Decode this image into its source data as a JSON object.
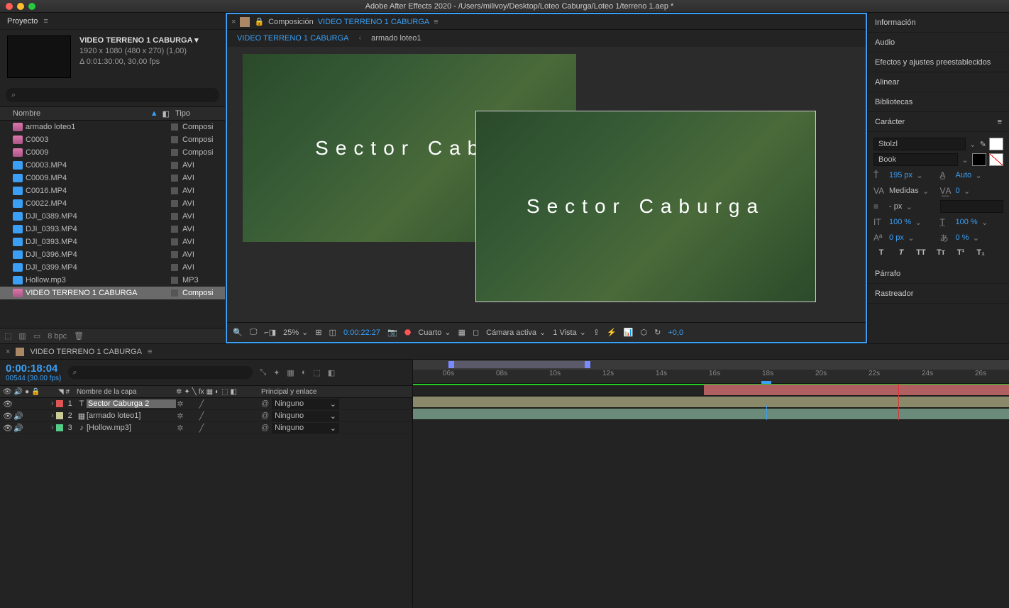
{
  "app": {
    "title": "Adobe After Effects 2020 - /Users/milivoy/Desktop/Loteo Caburga/Loteo 1/terreno 1.aep *"
  },
  "project": {
    "panel_title": "Proyecto",
    "comp_name": "VIDEO TERRENO 1 CABURGA ▾",
    "resolution": "1920 x 1080  (480 x 270) (1,00)",
    "duration": "Δ 0:01:30:00, 30,00 fps",
    "search_icon": "⌕",
    "columns": {
      "name": "Nombre",
      "type": "Tipo"
    },
    "items": [
      {
        "name": "armado loteo1",
        "type": "Composi",
        "icon": "comp"
      },
      {
        "name": "C0003",
        "type": "Composi",
        "icon": "comp"
      },
      {
        "name": "C0009",
        "type": "Composi",
        "icon": "comp"
      },
      {
        "name": "C0003.MP4",
        "type": "AVI",
        "icon": "avi"
      },
      {
        "name": "C0009.MP4",
        "type": "AVI",
        "icon": "avi"
      },
      {
        "name": "C0016.MP4",
        "type": "AVI",
        "icon": "avi"
      },
      {
        "name": "C0022.MP4",
        "type": "AVI",
        "icon": "avi"
      },
      {
        "name": "DJI_0389.MP4",
        "type": "AVI",
        "icon": "avi"
      },
      {
        "name": "DJI_0393.MP4",
        "type": "AVI",
        "icon": "avi"
      },
      {
        "name": "DJI_0393.MP4",
        "type": "AVI",
        "icon": "avi"
      },
      {
        "name": "DJI_0396.MP4",
        "type": "AVI",
        "icon": "avi"
      },
      {
        "name": "DJI_0399.MP4",
        "type": "AVI",
        "icon": "avi"
      },
      {
        "name": "Hollow.mp3",
        "type": "MP3",
        "icon": "mp3"
      },
      {
        "name": "VIDEO TERRENO 1 CABURGA",
        "type": "Composi",
        "icon": "comp",
        "selected": true
      }
    ],
    "footer_bpc": "8 bpc"
  },
  "viewer": {
    "tab_prefix": "Composición",
    "tab_name": "VIDEO TERRENO 1 CABURGA",
    "breadcrumb": [
      {
        "label": "VIDEO TERRENO 1 CABURGA",
        "active": true
      },
      {
        "label": "armado loteo1",
        "active": false
      }
    ],
    "overlay_text_1": "Sector Cabu",
    "overlay_text_2": "Sector Caburga",
    "footer": {
      "zoom": "25%",
      "timecode": "0:00:22:27",
      "quality": "Cuarto",
      "camera": "Cámara activa",
      "views": "1 Vista",
      "exposure": "+0,0"
    }
  },
  "right_panels": {
    "info": "Información",
    "audio": "Audio",
    "effects": "Efectos y ajustes preestablecidos",
    "align": "Alinear",
    "libraries": "Bibliotecas",
    "character": "Carácter",
    "paragraph": "Párrafo",
    "tracker": "Rastreador"
  },
  "character": {
    "font": "Stolzl",
    "style": "Book",
    "size_value": "195",
    "size_unit": "px",
    "leading": "Auto",
    "kerning_label": "Medidas",
    "tracking": "0",
    "stroke_value": "-",
    "stroke_unit": "px",
    "vscale": "100",
    "hscale": "100",
    "baseline": "0",
    "tsume": "0",
    "pct": "%",
    "px": "px"
  },
  "timeline": {
    "tab": "VIDEO TERRENO 1 CABURGA",
    "timecode": "0:00:18:04",
    "frame_info": "00544 (30.00 fps)",
    "search_icon": "⌕",
    "columns": {
      "layer_name": "Nombre de la capa",
      "parent": "Principal y enlace"
    },
    "parent_none": "Ninguno",
    "layers": [
      {
        "num": "1",
        "name": "Sector Caburga 2",
        "icon": "T",
        "color": "red",
        "selected": true
      },
      {
        "num": "2",
        "name": "[armado loteo1]",
        "icon": "▦",
        "color": "yel",
        "selected": false
      },
      {
        "num": "3",
        "name": "[Hollow.mp3]",
        "icon": "♪",
        "color": "grn",
        "selected": false
      }
    ],
    "ruler": [
      "06s",
      "08s",
      "10s",
      "12s",
      "14s",
      "16s",
      "18s",
      "20s",
      "22s",
      "24s",
      "26s"
    ]
  }
}
